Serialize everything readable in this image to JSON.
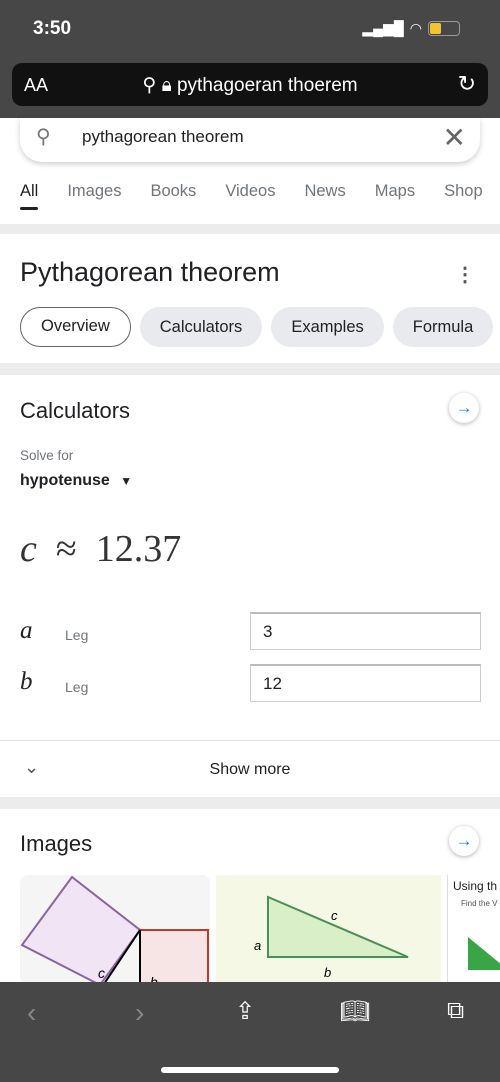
{
  "status": {
    "time": "3:50"
  },
  "browser": {
    "text_size": "AA",
    "url": "pythagoeran thoerem"
  },
  "search": {
    "query": "pythagorean theorem"
  },
  "tabs": [
    "All",
    "Images",
    "Books",
    "Videos",
    "News",
    "Maps",
    "Shop"
  ],
  "panel": {
    "title": "Pythagorean theorem",
    "chips": [
      "Overview",
      "Calculators",
      "Examples",
      "Formula"
    ]
  },
  "calculator": {
    "heading": "Calculators",
    "solve_for_label": "Solve for",
    "solve_for_value": "hypotenuse",
    "result_var": "c",
    "approx": "≈",
    "result": "12.37",
    "inputs": [
      {
        "var": "a",
        "label": "Leg",
        "value": "3"
      },
      {
        "var": "b",
        "label": "Leg",
        "value": "12"
      }
    ],
    "show_more": "Show more"
  },
  "images": {
    "heading": "Images",
    "img1_labels": [
      "c",
      "b"
    ],
    "img2_labels": [
      "a",
      "c",
      "b"
    ],
    "img3_title": "Using th",
    "img3_sub": "Find the V"
  }
}
